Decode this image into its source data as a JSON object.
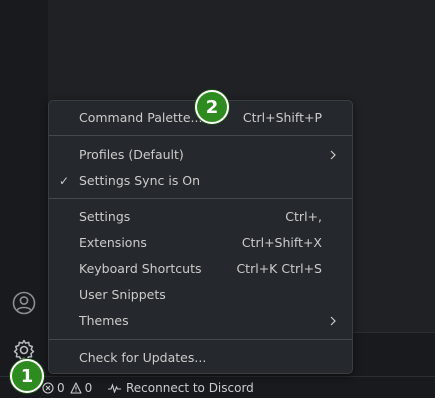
{
  "menu": {
    "items": [
      {
        "label": "Command Palette...",
        "shortcut": "Ctrl+Shift+P"
      },
      {
        "label": "Profiles (Default)",
        "shortcut": ""
      },
      {
        "label": "Settings Sync is On",
        "shortcut": "",
        "checked": true
      },
      {
        "label": "Settings",
        "shortcut": "Ctrl+,"
      },
      {
        "label": "Extensions",
        "shortcut": "Ctrl+Shift+X"
      },
      {
        "label": "Keyboard Shortcuts",
        "shortcut": "Ctrl+K Ctrl+S"
      },
      {
        "label": "User Snippets",
        "shortcut": ""
      },
      {
        "label": "Themes",
        "shortcut": ""
      },
      {
        "label": "Check for Updates...",
        "shortcut": ""
      }
    ],
    "check_mark": "✓"
  },
  "status_bar": {
    "errors": "0",
    "warnings": "0",
    "discord": "Reconnect to Discord"
  },
  "annotations": {
    "badge_1": "1",
    "badge_2": "2"
  },
  "colors": {
    "badge_green": "#2e8b1f",
    "menu_background": "#25282c",
    "status_bar": "#181a1d"
  }
}
